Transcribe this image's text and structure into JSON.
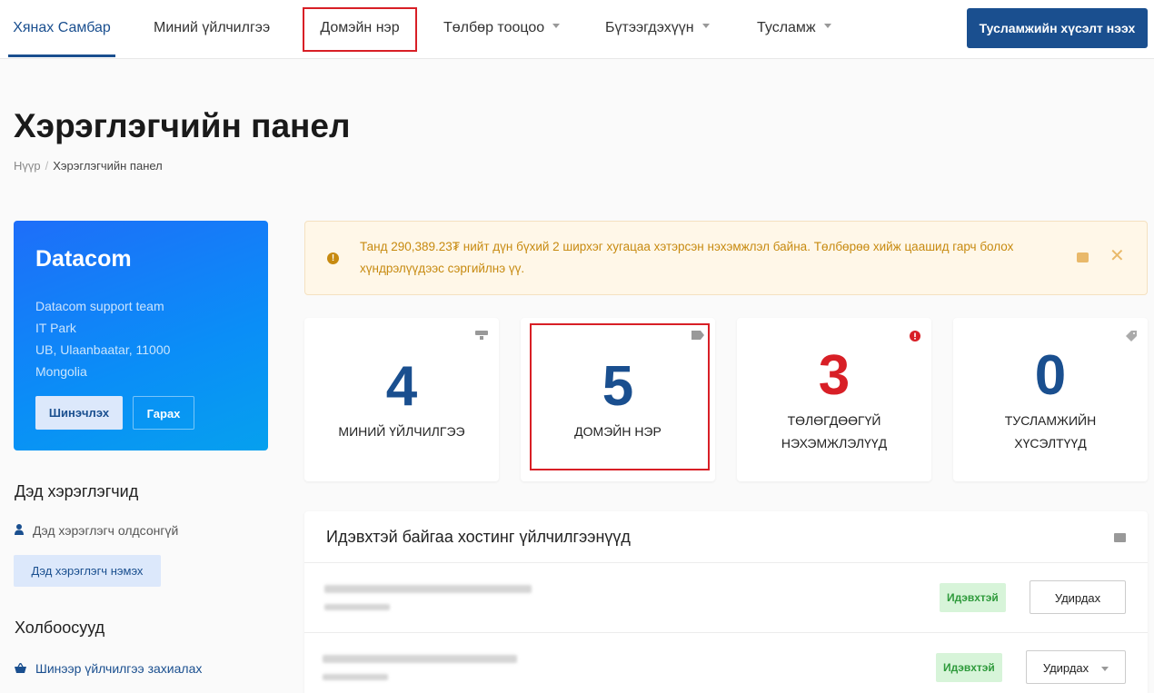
{
  "nav": {
    "items": [
      {
        "label": "Хянах Самбар",
        "dropdown": false
      },
      {
        "label": "Миний үйлчилгээ",
        "dropdown": false
      },
      {
        "label": "Домэйн нэр",
        "dropdown": false
      },
      {
        "label": "Төлбөр тооцоо",
        "dropdown": true
      },
      {
        "label": "Бүтээгдэхүүн",
        "dropdown": true
      },
      {
        "label": "Тусламж",
        "dropdown": true
      }
    ],
    "cta_label": "Тусламжийн хүсэлт нээх"
  },
  "page": {
    "title": "Хэрэглэгчийн панел",
    "breadcrumb_home": "Нүүр",
    "breadcrumb_current": "Хэрэглэгчийн панел"
  },
  "profile": {
    "name": "Datacom",
    "address_lines": [
      "Datacom support team",
      "IT Park",
      "UB, Ulaanbaatar, 11000",
      "Mongolia"
    ],
    "renew_label": "Шинэчлэх",
    "logout_label": "Гарах"
  },
  "subusers": {
    "heading": "Дэд хэрэглэгчид",
    "empty_text": "Дэд хэрэглэгч олдсонгүй",
    "add_label": "Дэд хэрэглэгч нэмэх"
  },
  "links": {
    "heading": "Холбоосууд",
    "order_new_service": "Шинээр үйлчилгээ захиалах"
  },
  "alert": {
    "text": "Танд 290,389.23₮ нийт дүн бүхий 2 ширхэг хугацаа хэтэрсэн нэхэмжлэл байна. Төлбөрөө хийж цаашид гарч болох хүндрэлүүдээс сэргийлнэ үү."
  },
  "stats": [
    {
      "value": "4",
      "label": "Миний үйлчилгээ",
      "icon": "server-icon"
    },
    {
      "value": "5",
      "label": "Домэйн нэр",
      "icon": "tag-icon"
    },
    {
      "value": "3",
      "label_line1": "Төлөгдөөгүй",
      "label_line2": "нэхэмжлэлүүд",
      "icon": "alert-icon"
    },
    {
      "value": "0",
      "label_line1": "Тусламжийн",
      "label_line2": "хүсэлтүүд",
      "icon": "ticket-icon"
    }
  ],
  "hosting": {
    "title": "Идэвхтэй байгаа хостинг үйлчилгээнүүд",
    "rows": [
      {
        "status": "Идэвхтэй",
        "manage_label": "Удирдах"
      },
      {
        "status": "Идэвхтэй",
        "manage_label": "Удирдах"
      }
    ]
  },
  "colors": {
    "brand": "#1a4f8f",
    "danger": "#d81f26",
    "warning_text": "#c78a10",
    "success_bg": "#d7f4d9",
    "success_text": "#2e9a3b"
  }
}
